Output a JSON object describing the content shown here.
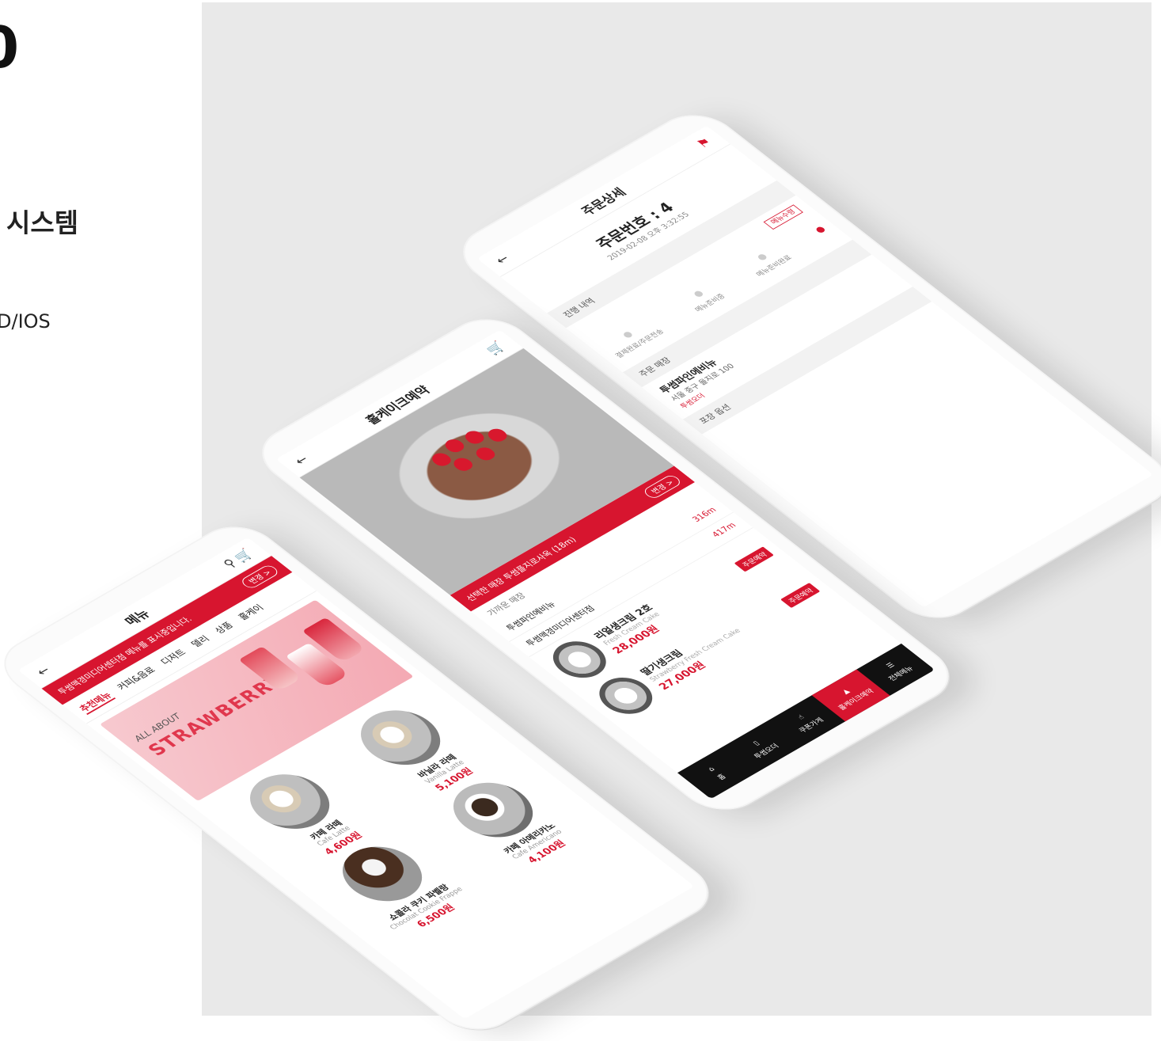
{
  "left": {
    "big_letter": "0",
    "subtitle": "시스템",
    "platform": "D/IOS"
  },
  "menu_screen": {
    "title": "메뉴",
    "notice": "투썸맥경미디어센터점 메뉴를 표시중입니다.",
    "change_label": "변경 >",
    "tabs": [
      "추천메뉴",
      "커피&음료",
      "디저트",
      "델리",
      "상품",
      "홀케이"
    ],
    "banner_line1": "ALL ABOUT",
    "banner_line2": "STRAWBERRY",
    "items": [
      {
        "name": "카페 라떼",
        "name_en": "Cafe Latte",
        "price": "4,600원"
      },
      {
        "name": "바닐라 라떼",
        "name_en": "Vanilla Latte",
        "price": "5,100원"
      },
      {
        "name": "쇼콜라 쿠키 파벨랑",
        "name_en": "Chocolat Cookie Frappe",
        "price": "6,500원"
      },
      {
        "name": "카페 아메리카노",
        "name_en": "Cafe Americano",
        "price": "4,100원"
      }
    ]
  },
  "cake_screen": {
    "title": "홀케이크예약",
    "selected_store": "선택한 매장 투썸플지로사옥 (18m)",
    "change_label": "변경 >",
    "nearby_label": "가까운 매장",
    "stores": [
      {
        "name": "투썸파인에비뉴",
        "distance": "316m"
      },
      {
        "name": "투썸맥경미디어센터점",
        "distance": "417m"
      }
    ],
    "cakes": [
      {
        "name": "리얼생크림 2호",
        "name_en": "Fresh Cream Cake",
        "price": "28,000원",
        "tag": "주문예약"
      },
      {
        "name": "딸기생크림",
        "name_en": "Strawberry Fresh Cream Cake",
        "price": "27,000원",
        "tag": "주문예약"
      }
    ],
    "nav": [
      "홈",
      "투썸오더",
      "쿠폰가게",
      "홀케이크예약",
      "전체메뉴"
    ]
  },
  "order_screen": {
    "title": "주문상세",
    "order_no": "주문번호 : 4",
    "order_date": "2019-02-08 오후 3:32:55",
    "progress_label": "진행 내역",
    "status_tag": "메뉴수령",
    "steps": [
      "결제완료/주문전송",
      "메뉴준비중",
      "메뉴준비완료"
    ],
    "store_label": "주문 매장",
    "store_name": "투썸파인에비뉴",
    "store_addr": "서울 중구 을지로 100",
    "store_phone": "투썸오더",
    "pack_label": "포장 옵션"
  },
  "colors": {
    "brand": "#d7152f",
    "background": "#e9e9e9"
  }
}
